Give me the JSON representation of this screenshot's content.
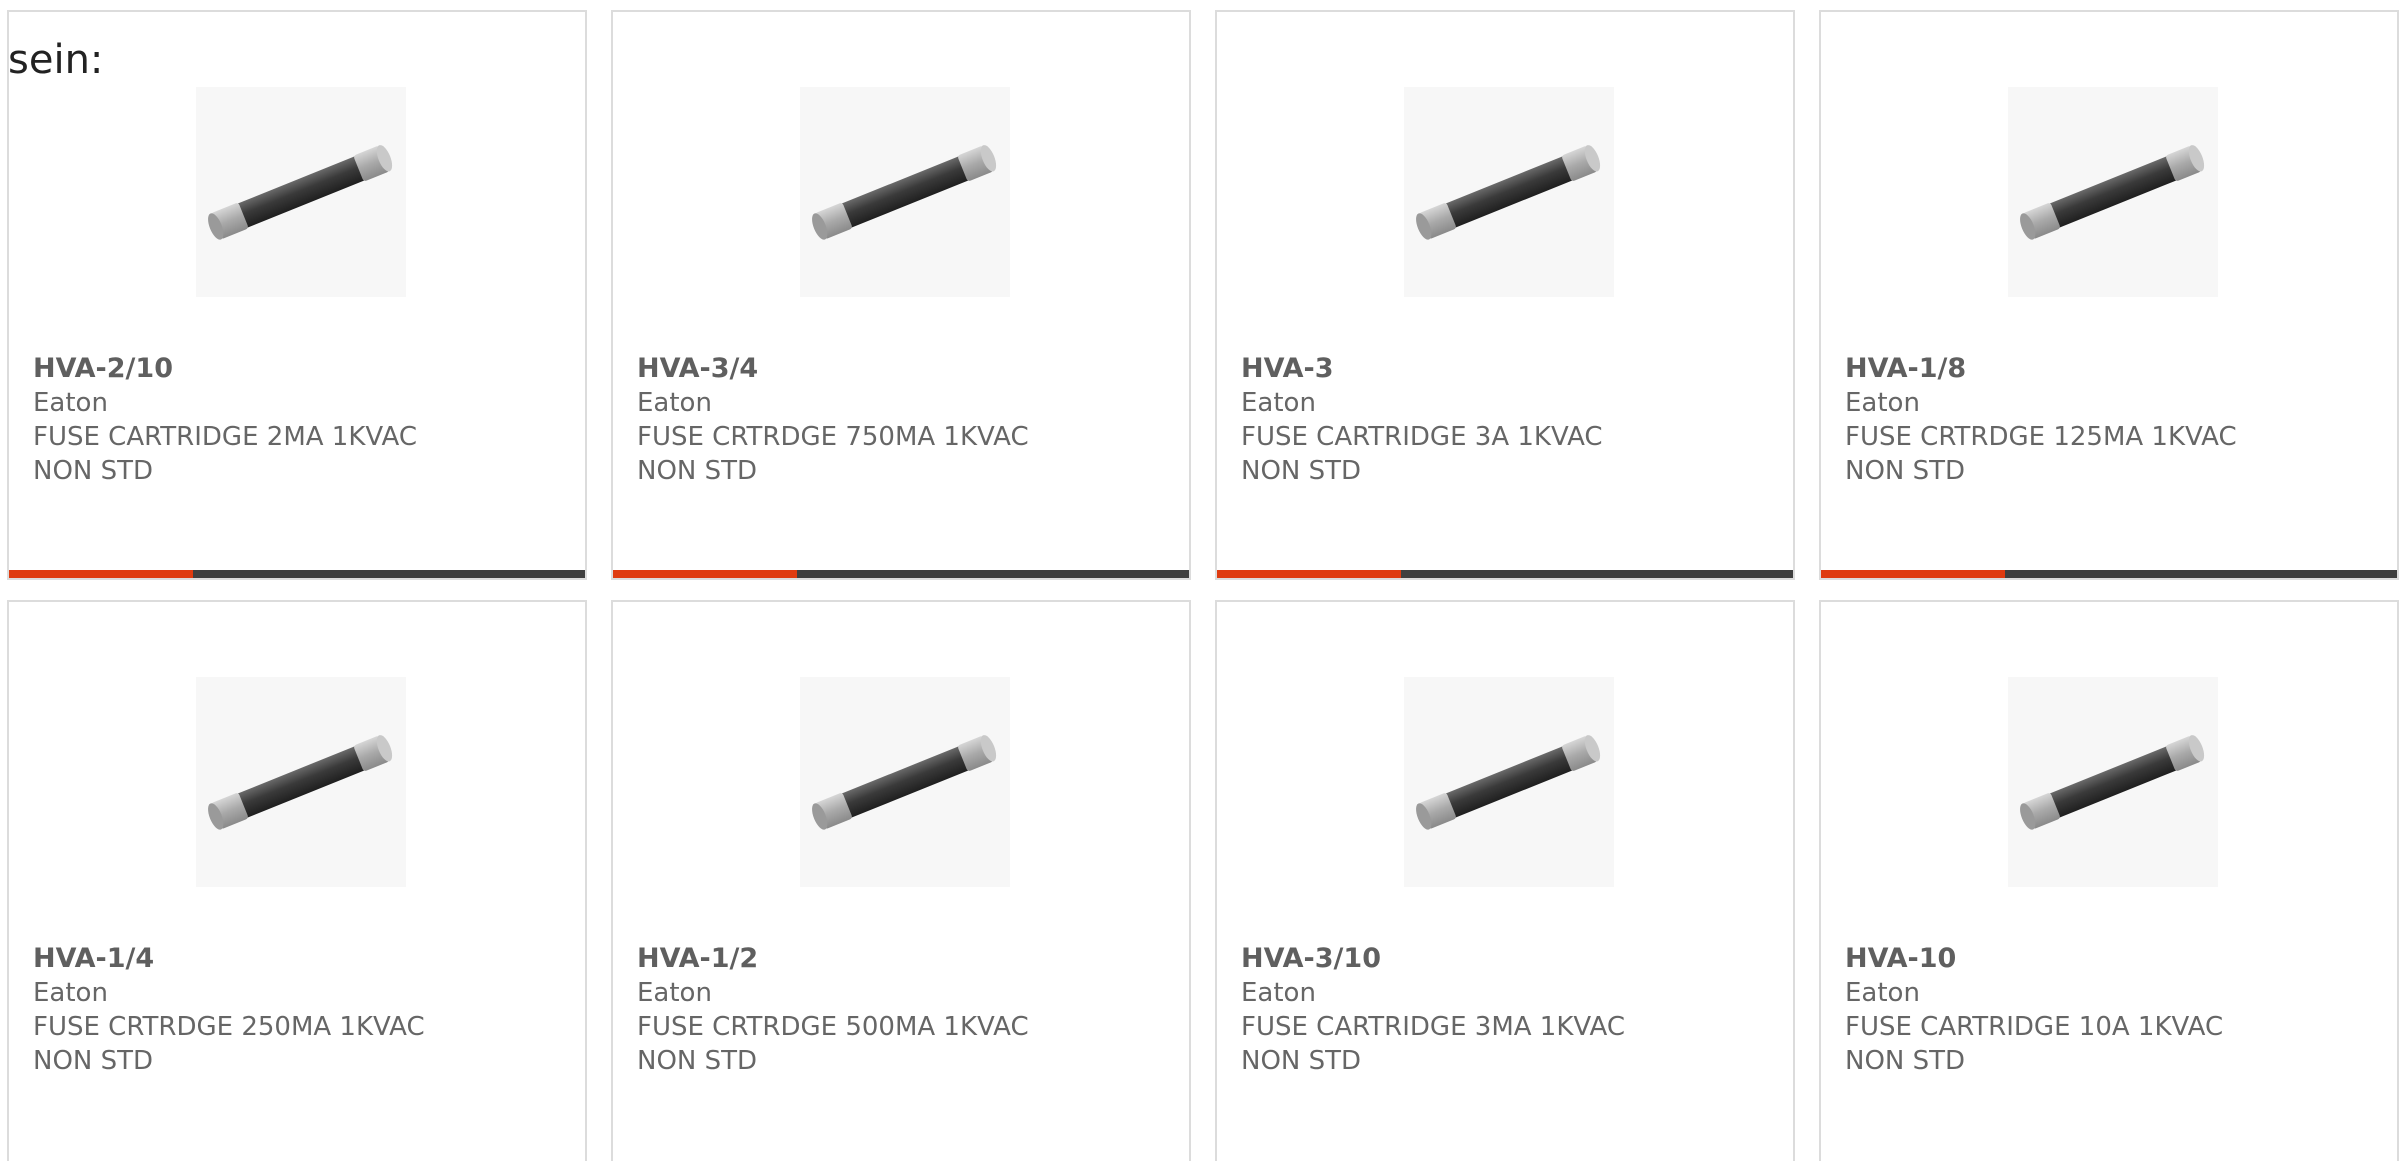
{
  "intro_text": "sein:",
  "colors": {
    "accent": "#df3b10",
    "bar_track": "#3f3f3f",
    "text": "#666666",
    "border": "#dcdcdc"
  },
  "image_icon": "fuse-cartridge-icon",
  "products": [
    {
      "part": "HVA-2/10",
      "maker": "Eaton",
      "desc": "FUSE CARTRIDGE 2MA 1KVAC NON STD",
      "progress": 0.32
    },
    {
      "part": "HVA-3/4",
      "maker": "Eaton",
      "desc": "FUSE CRTRDGE 750MA 1KVAC NON STD",
      "progress": 0.32
    },
    {
      "part": "HVA-3",
      "maker": "Eaton",
      "desc": "FUSE CARTRIDGE 3A 1KVAC NON STD",
      "progress": 0.32
    },
    {
      "part": "HVA-1/8",
      "maker": "Eaton",
      "desc": "FUSE CRTRDGE 125MA 1KVAC NON STD",
      "progress": 0.32
    },
    {
      "part": "HVA-1/4",
      "maker": "Eaton",
      "desc": "FUSE CRTRDGE 250MA 1KVAC NON STD"
    },
    {
      "part": "HVA-1/2",
      "maker": "Eaton",
      "desc": "FUSE CRTRDGE 500MA 1KVAC NON STD"
    },
    {
      "part": "HVA-3/10",
      "maker": "Eaton",
      "desc": "FUSE CARTRIDGE 3MA 1KVAC NON STD"
    },
    {
      "part": "HVA-10",
      "maker": "Eaton",
      "desc": "FUSE CARTRIDGE 10A 1KVAC NON STD"
    }
  ]
}
